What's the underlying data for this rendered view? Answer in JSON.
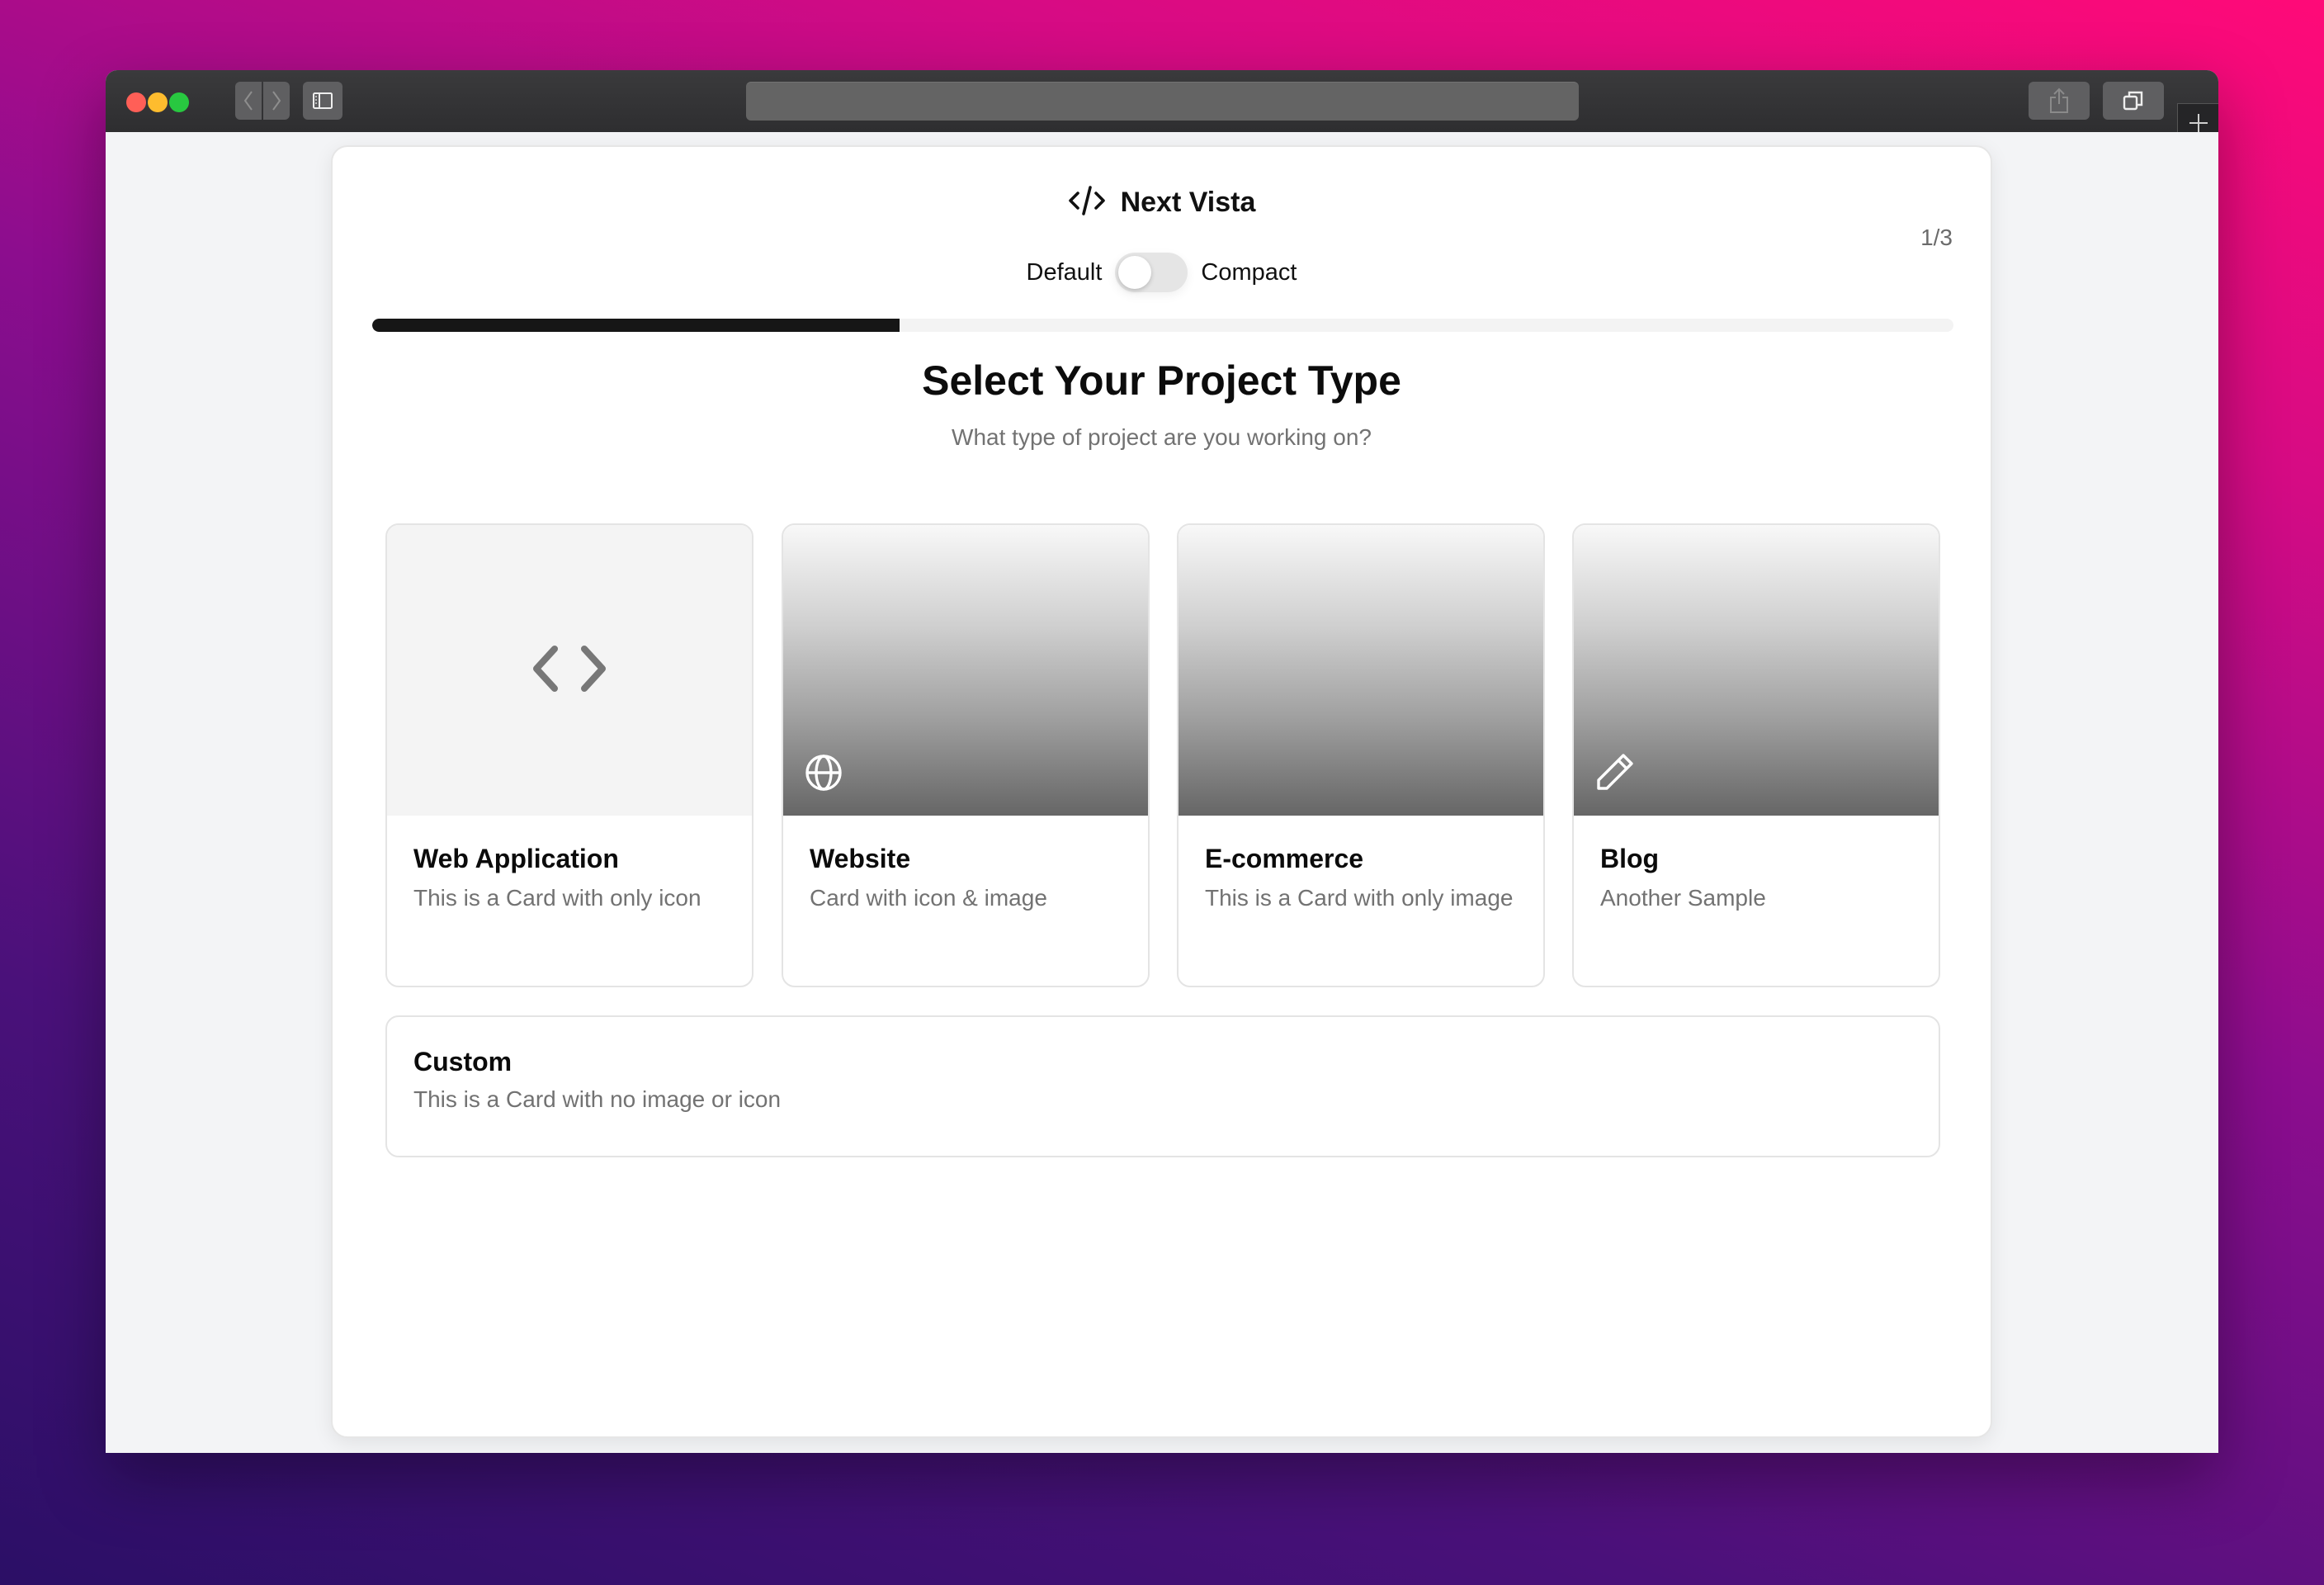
{
  "browser": {
    "traffic_lights": [
      "close",
      "minimize",
      "maximize"
    ],
    "toolbar_icons": [
      "back-icon",
      "forward-icon",
      "sidebar-icon",
      "share-icon",
      "tabs-icon",
      "new-tab-icon"
    ],
    "address_value": ""
  },
  "header": {
    "logo_icon": "code-icon",
    "app_name": "Next Vista",
    "step_counter": "1/3",
    "toggle": {
      "left_label": "Default",
      "right_label": "Compact",
      "checked": false
    },
    "progress": {
      "current_step": 1,
      "total_steps": 3,
      "fraction": 0.3333
    }
  },
  "main": {
    "title": "Select Your Project Type",
    "subtitle": "What type of project are you working on?",
    "options": [
      {
        "title": "Web Application",
        "description": "This is a Card with only icon",
        "icon": "code-brackets-icon",
        "media": "icon-only"
      },
      {
        "title": "Website",
        "description": "Card with icon & image",
        "icon": "globe-icon",
        "media": "image-with-icon"
      },
      {
        "title": "E-commerce",
        "description": "This is a Card with only image",
        "icon": null,
        "media": "image-only"
      },
      {
        "title": "Blog",
        "description": "Another Sample",
        "icon": "pencil-icon",
        "media": "image-with-icon"
      }
    ],
    "custom_option": {
      "title": "Custom",
      "description": "This is a Card with no image or icon"
    }
  },
  "colors": {
    "progress_fill": "#161616",
    "progress_track": "#f3f3f3",
    "traffic_red": "#ff5f57",
    "traffic_yellow": "#febc2e",
    "traffic_green": "#28c840"
  }
}
